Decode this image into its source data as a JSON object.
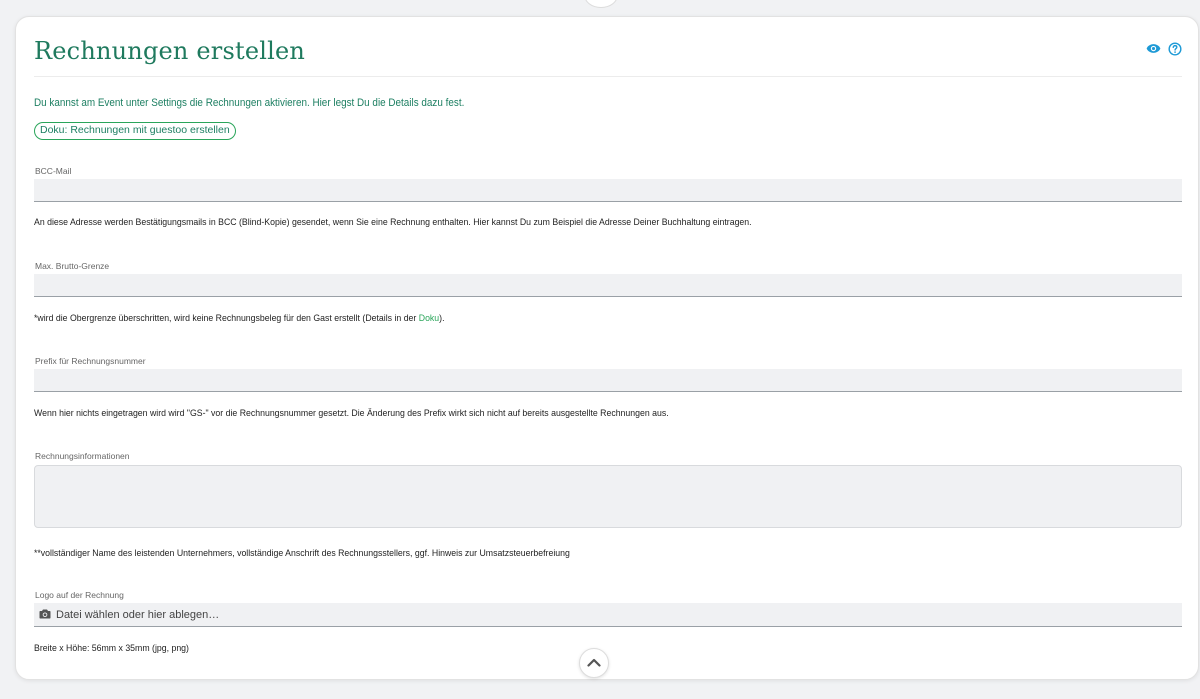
{
  "header": {
    "title": "Rechnungen erstellen",
    "icons": [
      "eye-icon",
      "help-circle-icon"
    ],
    "accent_color": "#1f7a5e",
    "link_color": "#2aa55a"
  },
  "intro": {
    "text": "Du kannst am Event unter Settings die Rechnungen aktivieren. Hier legst Du die Details dazu fest.",
    "doc_link": "Doku: Rechnungen mit guestoo erstellen"
  },
  "fields": {
    "bcc": {
      "label": "BCC-Mail",
      "value": "",
      "help": "An diese Adresse werden Bestätigungsmails in BCC (Blind-Kopie) gesendet, wenn Sie eine Rechnung enthalten. Hier kannst Du zum Beispiel die Adresse Deiner Buchhaltung eintragen."
    },
    "max_gross": {
      "label": "Max. Brutto-Grenze",
      "value": "",
      "help_prefix": "*wird die Obergrenze überschritten, wird keine Rechnungsbeleg für den Gast erstellt (Details in der ",
      "help_link": "Doku",
      "help_suffix": ")."
    },
    "prefix": {
      "label": "Prefix für Rechnungsnummer",
      "value": "",
      "help": "Wenn hier nichts eingetragen wird wird \"GS-\" vor die Rechnungsnummer gesetzt. Die Änderung des Prefix wirkt sich nicht auf bereits ausgestellte Rechnungen aus."
    },
    "invoice_info": {
      "label": "Rechnungsinformationen",
      "value": "",
      "help": "**vollständiger Name des leistenden Unternehmers, vollständige Anschrift des Rechnungsstellers, ggf. Hinweis zur Umsatzsteuerbefreiung"
    },
    "logo": {
      "label": "Logo auf der Rechnung",
      "placeholder": "Datei wählen oder hier ablegen…",
      "help": "Breite x Höhe: 56mm x 35mm (jpg, png)"
    }
  }
}
